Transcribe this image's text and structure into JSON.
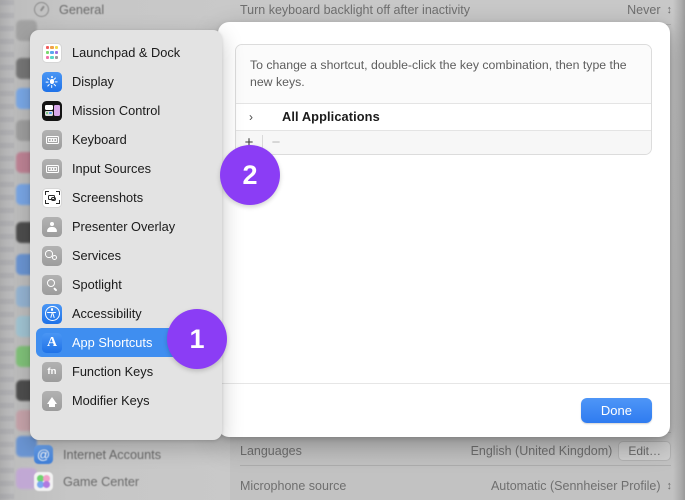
{
  "window": {
    "accent_blue": "#3f8ef0",
    "badge_purple": "#8b3df5",
    "selected_row_blue": "#3f8ef0"
  },
  "background": {
    "sidebar_top_item": {
      "label": "General",
      "icon": "gear-icon"
    },
    "content_rows": [
      {
        "label": "Turn keyboard backlight off after inactivity",
        "value": "Never",
        "control": "stepper"
      },
      {
        "label": "Languages",
        "value": "English (United Kingdom)",
        "control": "edit-button",
        "button_label": "Edit…"
      },
      {
        "label": "Microphone source",
        "value": "Automatic (Sennheiser Profile)",
        "control": "stepper"
      }
    ],
    "sidebar_bottom_items": [
      {
        "label": "Internet Accounts",
        "icon": "at-sign-icon"
      },
      {
        "label": "Game Center",
        "icon": "game-center-icon"
      }
    ]
  },
  "menu": {
    "items": [
      {
        "label": "Launchpad & Dock",
        "icon": "launchpad-icon",
        "selected": false
      },
      {
        "label": "Display",
        "icon": "display-icon",
        "selected": false
      },
      {
        "label": "Mission Control",
        "icon": "mission-control-icon",
        "selected": false
      },
      {
        "label": "Keyboard",
        "icon": "keyboard-icon",
        "selected": false
      },
      {
        "label": "Input Sources",
        "icon": "input-sources-icon",
        "selected": false
      },
      {
        "label": "Screenshots",
        "icon": "screenshots-icon",
        "selected": false
      },
      {
        "label": "Presenter Overlay",
        "icon": "presenter-overlay-icon",
        "selected": false
      },
      {
        "label": "Services",
        "icon": "services-icon",
        "selected": false
      },
      {
        "label": "Spotlight",
        "icon": "spotlight-icon",
        "selected": false
      },
      {
        "label": "Accessibility",
        "icon": "accessibility-icon",
        "selected": false
      },
      {
        "label": "App Shortcuts",
        "icon": "app-shortcuts-icon",
        "selected": true
      },
      {
        "label": "Function Keys",
        "icon": "function-keys-icon",
        "selected": false
      },
      {
        "label": "Modifier Keys",
        "icon": "modifier-keys-icon",
        "selected": false
      }
    ]
  },
  "popover": {
    "hint": "To change a shortcut, double-click the key combination, then type the new keys.",
    "group_row": {
      "disclosure": "›",
      "title": "All Applications"
    },
    "toolbar": {
      "add_label": "+",
      "remove_label": "−",
      "remove_disabled": true
    },
    "done_label": "Done"
  },
  "annotations": [
    {
      "id": "badge-1",
      "label": "1"
    },
    {
      "id": "badge-2",
      "label": "2"
    }
  ]
}
